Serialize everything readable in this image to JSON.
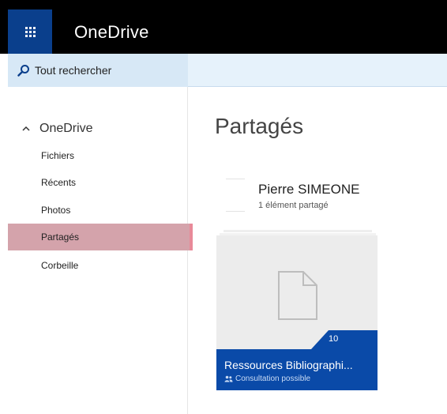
{
  "app": {
    "title": "OneDrive"
  },
  "search": {
    "label": "Tout rechercher"
  },
  "nav": {
    "root_label": "OneDrive",
    "items": [
      {
        "label": "Fichiers"
      },
      {
        "label": "Récents"
      },
      {
        "label": "Photos"
      },
      {
        "label": "Partagés",
        "selected": true
      },
      {
        "label": "Corbeille"
      }
    ]
  },
  "main": {
    "title": "Partagés",
    "person": {
      "name": "Pierre SIMEONE",
      "count_text": "1 élément partagé"
    },
    "tile": {
      "name": "Ressources Bibliographi...",
      "permission": "Consultation possible",
      "count": "10"
    }
  },
  "colors": {
    "topbar": "#000000",
    "waffle": "#0a3f8c",
    "tile_footer": "#0a4aa8",
    "selected_nav": "#d4a3ab"
  }
}
